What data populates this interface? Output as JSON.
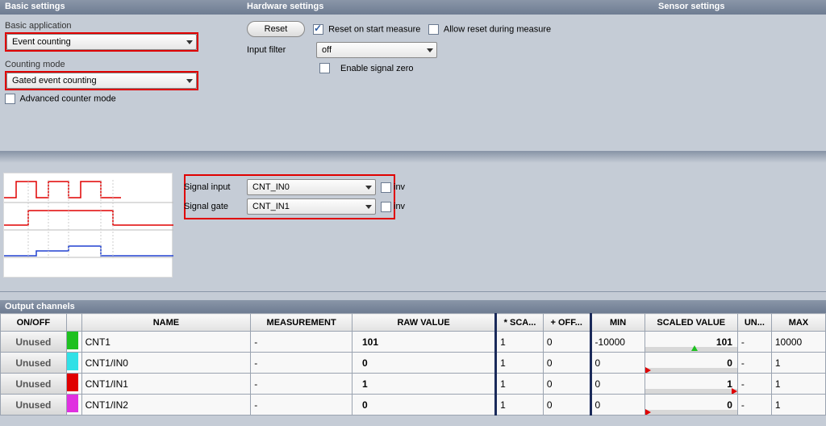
{
  "headers": {
    "basic": "Basic settings",
    "hardware": "Hardware settings",
    "sensor": "Sensor settings",
    "output": "Output channels"
  },
  "basic": {
    "app_label": "Basic application",
    "app_value": "Event counting",
    "mode_label": "Counting mode",
    "mode_value": "Gated event counting",
    "adv_label": "Advanced counter mode",
    "adv_checked": false
  },
  "hardware": {
    "reset_btn": "Reset",
    "reset_on_start": "Reset on start measure",
    "reset_on_start_checked": true,
    "allow_reset": "Allow reset during measure",
    "allow_reset_checked": false,
    "filter_label": "Input filter",
    "filter_value": "off",
    "enable_zero": "Enable signal zero",
    "enable_zero_checked": false
  },
  "signal": {
    "input_label": "Signal input",
    "input_value": "CNT_IN0",
    "gate_label": "Signal gate",
    "gate_value": "CNT_IN1",
    "inv_label": "inv",
    "inv_input_checked": false,
    "inv_gate_checked": false
  },
  "table": {
    "cols": {
      "onoff": "ON/OFF",
      "color": "",
      "name": "NAME",
      "meas": "MEASUREMENT",
      "raw": "RAW VALUE",
      "sca": "* SCA...",
      "off": "+ OFF...",
      "min": "MIN",
      "scaled": "SCALED VALUE",
      "un": "UN...",
      "max": "MAX"
    },
    "rows": [
      {
        "onoff": "Unused",
        "color": "#1ec020",
        "name": "CNT1",
        "meas": "-",
        "raw": "101",
        "sca": "1",
        "off": "0",
        "min": "-10000",
        "scaled": "101",
        "un": "-",
        "max": "10000",
        "marker": "green",
        "mpos": 50
      },
      {
        "onoff": "Unused",
        "color": "#31e0e6",
        "name": "CNT1/IN0",
        "meas": "-",
        "raw": "0",
        "sca": "1",
        "off": "0",
        "min": "0",
        "scaled": "0",
        "un": "-",
        "max": "1",
        "marker": "red",
        "mpos": 0
      },
      {
        "onoff": "Unused",
        "color": "#e00000",
        "name": "CNT1/IN1",
        "meas": "-",
        "raw": "1",
        "sca": "1",
        "off": "0",
        "min": "0",
        "scaled": "1",
        "un": "-",
        "max": "1",
        "marker": "red",
        "mpos": 94
      },
      {
        "onoff": "Unused",
        "color": "#e030e0",
        "name": "CNT1/IN2",
        "meas": "-",
        "raw": "0",
        "sca": "1",
        "off": "0",
        "min": "0",
        "scaled": "0",
        "un": "-",
        "max": "1",
        "marker": "red",
        "mpos": 0
      }
    ]
  }
}
